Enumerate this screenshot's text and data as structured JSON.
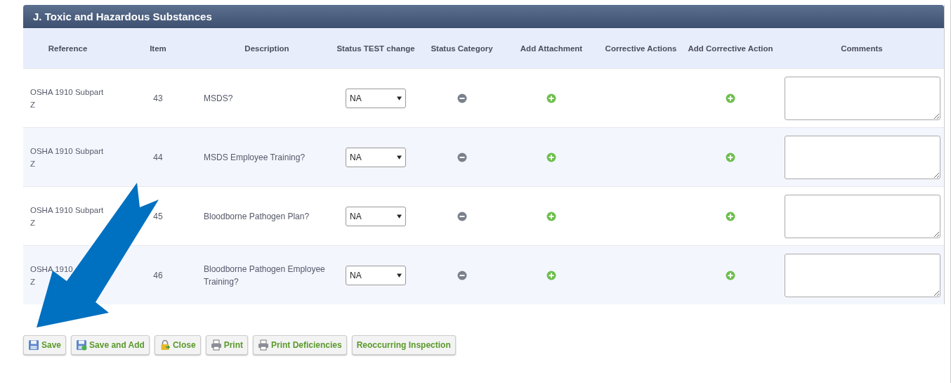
{
  "panel": {
    "title": "J. Toxic and Hazardous Substances"
  },
  "table": {
    "columns": [
      "Reference",
      "Item",
      "Description",
      "Status TEST change",
      "Status Category",
      "Add Attachment",
      "Corrective Actions",
      "Add Corrective Action",
      "Comments"
    ],
    "rows": [
      {
        "reference": [
          "OSHA 1910 Subpart",
          "Z"
        ],
        "item": "43",
        "description": "MSDS?",
        "status": "NA"
      },
      {
        "reference": [
          "OSHA 1910 Subpart",
          "Z"
        ],
        "item": "44",
        "description": "MSDS Employee Training?",
        "status": "NA"
      },
      {
        "reference": [
          "OSHA 1910 Subpart",
          "Z"
        ],
        "item": "45",
        "description": "Bloodborne Pathogen Plan?",
        "status": "NA"
      },
      {
        "reference": [
          "OSHA 1910",
          "Z"
        ],
        "item": "46",
        "description": "Bloodborne Pathogen Employee Training?",
        "status": "NA"
      }
    ]
  },
  "buttons": [
    {
      "label": "Save",
      "kind": "save"
    },
    {
      "label": "Save and Add",
      "kind": "save-add"
    },
    {
      "label": "Close",
      "kind": "lock"
    },
    {
      "label": "Print",
      "kind": "print"
    },
    {
      "label": "Print Deficiencies",
      "kind": "print"
    },
    {
      "label": "Reoccurring Inspection",
      "kind": "none"
    }
  ]
}
